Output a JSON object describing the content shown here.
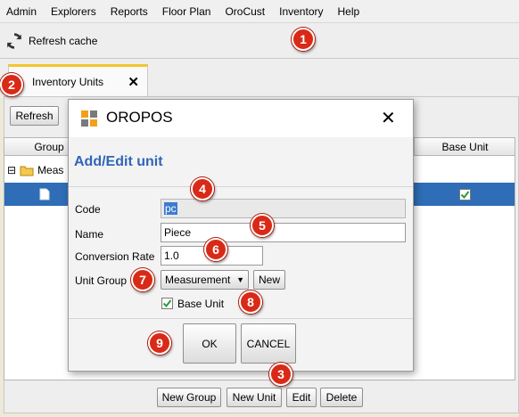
{
  "menu": [
    "Admin",
    "Explorers",
    "Reports",
    "Floor Plan",
    "OroCust",
    "Inventory",
    "Help"
  ],
  "toolbar": {
    "refresh_cache_label": "Refresh cache"
  },
  "tab": {
    "label": "Inventory Units",
    "close": "✕"
  },
  "content": {
    "refresh_label": "Refresh",
    "columns": {
      "group": "Group",
      "base_unit": "Base Unit"
    },
    "tree_group_label": "Meas",
    "tree_collapse": "⊟",
    "selected_row": {
      "base_unit_checked": true
    }
  },
  "bottom_buttons": {
    "new_group": "New Group",
    "new_unit": "New Unit",
    "edit": "Edit",
    "delete": "Delete"
  },
  "dialog": {
    "app_title": "OROPOS",
    "close": "✕",
    "heading": "Add/Edit unit",
    "code_label": "Code",
    "code_value": "pc",
    "name_label": "Name",
    "name_value": "Piece",
    "conversion_label": "Conversion Rate",
    "conversion_value": "1.0",
    "unit_group_label": "Unit Group",
    "unit_group_value": "Measurement",
    "new_label": "New",
    "base_unit_label": "Base Unit",
    "base_unit_checked": true,
    "ok_label": "OK",
    "cancel_label": "CANCEL"
  },
  "badges": [
    "1",
    "2",
    "3",
    "4",
    "5",
    "6",
    "7",
    "8",
    "9"
  ],
  "colors": {
    "accent_tab": "#f4c430",
    "selection": "#2f6db6",
    "heading": "#2f65b8",
    "badge": "#d82a17",
    "check": "#2a9a3a"
  }
}
